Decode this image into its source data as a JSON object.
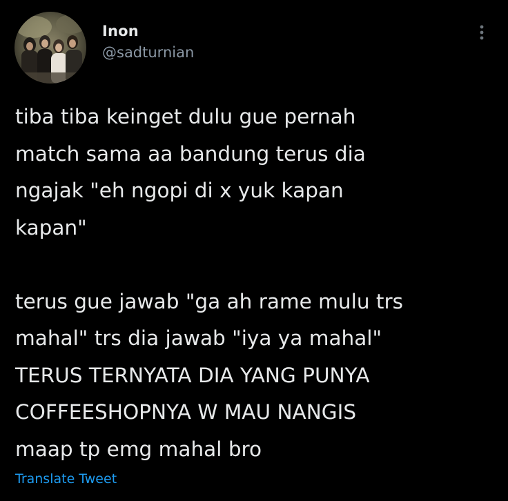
{
  "tweet": {
    "author": {
      "display_name": "Inon",
      "handle": "@sadturnian"
    },
    "more_icon": "more-options-icon",
    "paragraphs": [
      "tiba tiba keinget dulu gue pernah\nmatch sama aa bandung terus dia\nngajak \"eh ngopi di x yuk kapan\nkapan\"",
      "terus gue jawab \"ga ah rame mulu trs\nmahal\" trs dia jawab \"iya ya mahal\"\nTERUS TERNYATA DIA YANG PUNYA\nCOFFEESHOPNYA W MAU NANGIS\nmaap tp emg mahal bro"
    ],
    "translate_label": "Translate Tweet"
  },
  "colors": {
    "background": "#000000",
    "text_primary": "#e7e9ea",
    "text_secondary": "#8b98a5",
    "accent": "#1d9bf0"
  }
}
